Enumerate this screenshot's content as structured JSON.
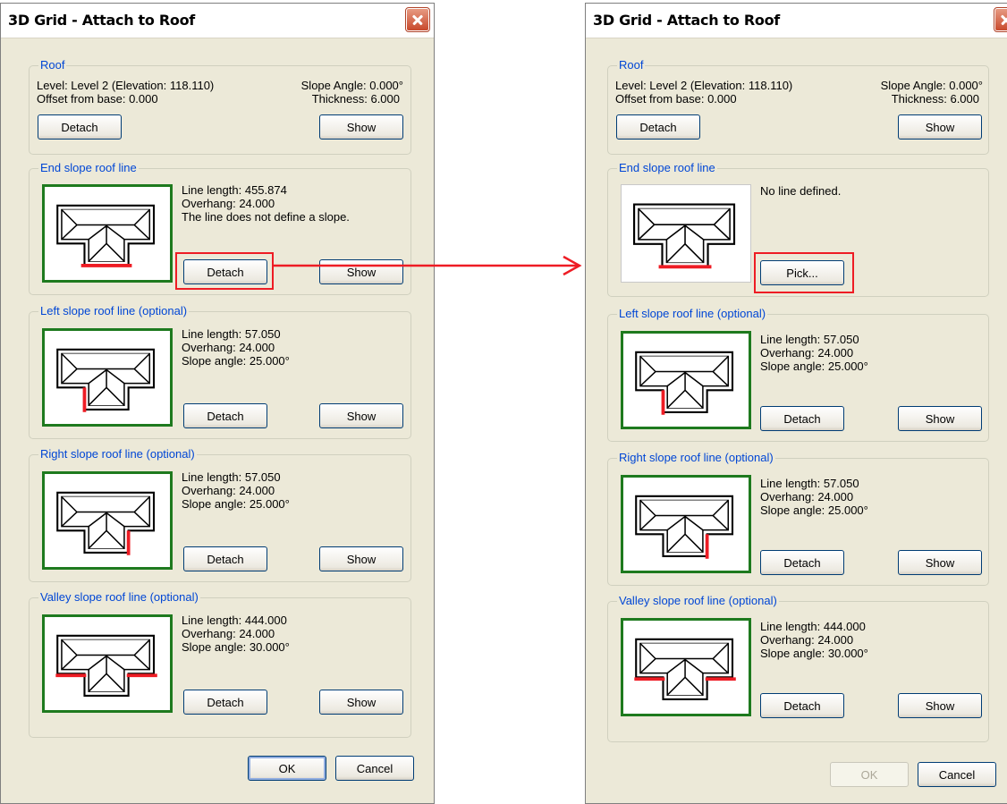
{
  "title": "3D Grid - Attach to Roof",
  "colors": {
    "group_label": "#0046d5",
    "thumb_border": "#1e7a1e",
    "highlight": "#ee1c24",
    "roof_line": "#ee1c24"
  },
  "roof": {
    "label": "Roof",
    "level": "Level: Level 2 (Elevation: 118.110)",
    "offset": "Offset from base: 0.000",
    "slope_angle": "Slope Angle: 0.000°",
    "thickness": "Thickness: 6.000",
    "detach": "Detach",
    "show": "Show"
  },
  "left_dialog": {
    "end": {
      "label": "End slope roof line",
      "line1": "Line length: 455.874",
      "line2": "Overhang: 24.000",
      "line3": "The line does not define a slope.",
      "detach": "Detach",
      "show": "Show"
    },
    "left": {
      "label": "Left slope roof line (optional)",
      "line1": "Line length: 57.050",
      "line2": "Overhang: 24.000",
      "line3": "Slope angle: 25.000°",
      "detach": "Detach",
      "show": "Show"
    },
    "right": {
      "label": "Right slope roof line (optional)",
      "line1": "Line length: 57.050",
      "line2": "Overhang: 24.000",
      "line3": "Slope angle: 25.000°",
      "detach": "Detach",
      "show": "Show"
    },
    "valley": {
      "label": "Valley slope roof line (optional)",
      "line1": "Line length: 444.000",
      "line2": "Overhang: 24.000",
      "line3": "Slope angle: 30.000°",
      "detach": "Detach",
      "show": "Show"
    },
    "ok": "OK",
    "cancel": "Cancel"
  },
  "right_dialog": {
    "end": {
      "label": "End slope roof line",
      "message": "No line defined.",
      "pick": "Pick..."
    },
    "left": {
      "label": "Left slope roof line (optional)",
      "line1": "Line length: 57.050",
      "line2": "Overhang: 24.000",
      "line3": "Slope angle: 25.000°",
      "detach": "Detach",
      "show": "Show"
    },
    "right": {
      "label": "Right slope roof line (optional)",
      "line1": "Line length: 57.050",
      "line2": "Overhang: 24.000",
      "line3": "Slope angle: 25.000°",
      "detach": "Detach",
      "show": "Show"
    },
    "valley": {
      "label": "Valley slope roof line (optional)",
      "line1": "Line length: 444.000",
      "line2": "Overhang: 24.000",
      "line3": "Slope angle: 30.000°",
      "detach": "Detach",
      "show": "Show"
    },
    "ok": "OK",
    "cancel": "Cancel"
  }
}
